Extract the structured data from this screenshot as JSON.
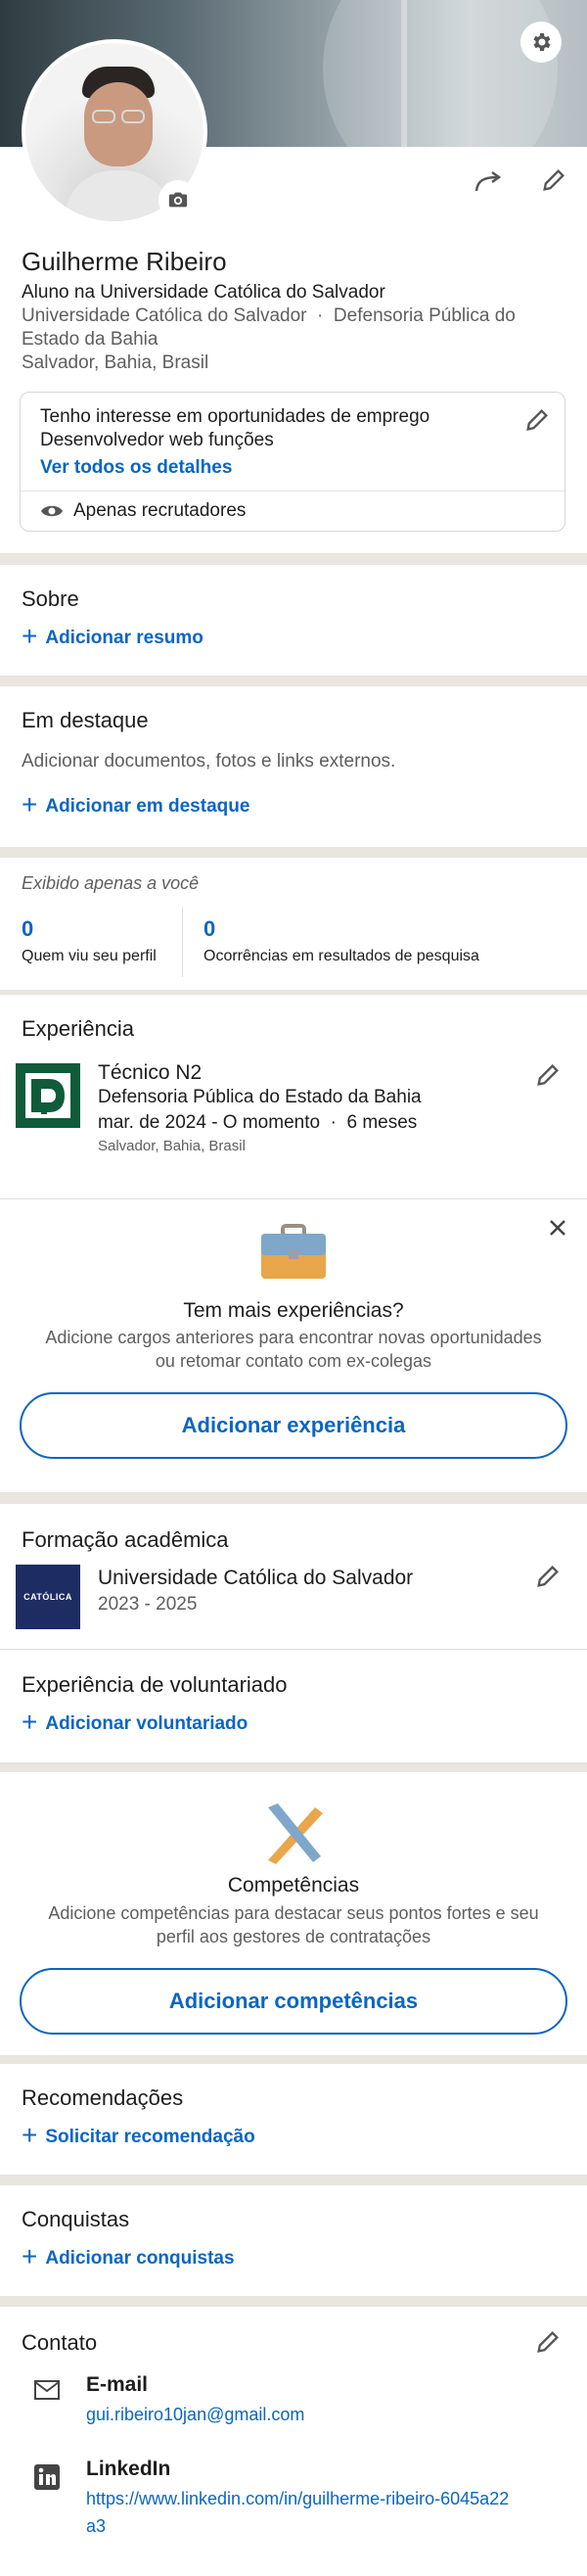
{
  "profile": {
    "name": "Guilherme Ribeiro",
    "headline": "Aluno na Universidade Católica do Salvador",
    "orgs_line1": "Universidade Católica do Salvador  ·  Defensoria Pública do",
    "orgs_line2": "Estado da Bahia",
    "location": "Salvador, Bahia, Brasil"
  },
  "open_to_work": {
    "title": "Tenho interesse em oportunidades de emprego",
    "subtitle": "Desenvolvedor web funções",
    "link": "Ver todos os detalhes",
    "visibility": "Apenas recrutadores"
  },
  "about": {
    "title": "Sobre",
    "add": "Adicionar resumo"
  },
  "featured": {
    "title": "Em destaque",
    "description": "Adicionar documentos, fotos e links externos.",
    "add": "Adicionar em destaque"
  },
  "analytics": {
    "note": "Exibido apenas a você",
    "views_count": "0",
    "views_label": "Quem viu seu perfil",
    "search_count": "0",
    "search_label": "Ocorrências em resultados de pesquisa"
  },
  "experience": {
    "title": "Experiência",
    "role": "Técnico N2",
    "company": "Defensoria Pública do Estado da Bahia",
    "dates": "mar. de 2024 - O momento  ·  6 meses",
    "location": "Salvador, Bahia, Brasil"
  },
  "more_experience": {
    "title": "Tem mais experiências?",
    "desc_line1": "Adicione cargos anteriores para encontrar novas oportunidades",
    "desc_line2": "ou retomar contato com ex-colegas",
    "button": "Adicionar experiência"
  },
  "education": {
    "title": "Formação acadêmica",
    "school": "Universidade Católica do Salvador",
    "years": "2023 - 2025",
    "logo_text": "CATÓLICA"
  },
  "volunteering": {
    "title": "Experiência de voluntariado",
    "add": "Adicionar voluntariado"
  },
  "skills": {
    "title": "Competências",
    "desc_line1": "Adicione competências para destacar seus pontos fortes e seu",
    "desc_line2": "perfil aos gestores de contratações",
    "button": "Adicionar competências"
  },
  "recommendations": {
    "title": "Recomendações",
    "add": "Solicitar recomendação"
  },
  "accomplishments": {
    "title": "Conquistas",
    "add": "Adicionar conquistas"
  },
  "contact": {
    "title": "Contato",
    "email_label": "E-mail",
    "email_value": "gui.ribeiro10jan@gmail.com",
    "linkedin_label": "LinkedIn",
    "linkedin_line1": "https://www.linkedin.com/in/guilherme-ribeiro-6045a22",
    "linkedin_line2": "a3"
  },
  "colors": {
    "accent": "#0a66c2",
    "separator": "#e9e5df"
  }
}
